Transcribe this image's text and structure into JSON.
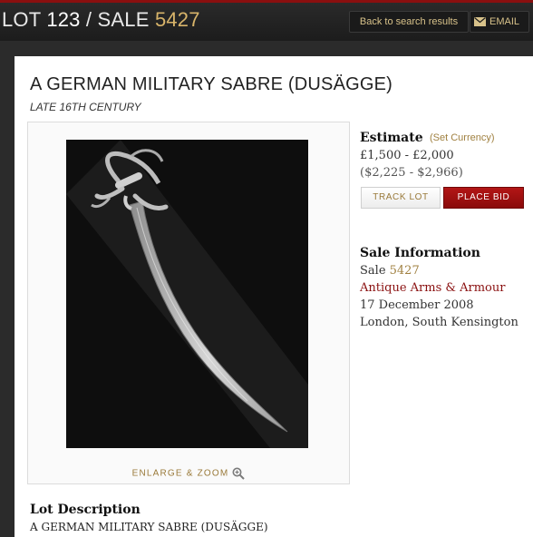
{
  "header": {
    "lot_prefix": "LOT ",
    "lot_number": "123",
    "separator": " / SALE ",
    "sale_number": "5427",
    "back_label": "Back to search results",
    "email_label": "EMAIL"
  },
  "lot": {
    "title": "A GERMAN MILITARY SABRE (DUSÄGGE)",
    "subtitle": "LATE 16TH CENTURY",
    "enlarge_label": "ENLARGE & ZOOM"
  },
  "estimate": {
    "label": "Estimate",
    "set_currency": "(Set Currency)",
    "gbp": "£1,500 - £2,000",
    "usd": "($2,225 - $2,966)",
    "track_label": "TRACK LOT",
    "bid_label": "PLACE BID"
  },
  "sale_info": {
    "label": "Sale Information",
    "sale_prefix": "Sale ",
    "sale_number": "5427",
    "sale_name": "Antique Arms & Armour",
    "date": "17 December 2008",
    "location": "London, South Kensington"
  },
  "description": {
    "label": "Lot Description",
    "text": "A GERMAN MILITARY SABRE (DUSÄGGE)"
  },
  "colors": {
    "accent_gold": "#d8b46a",
    "bid_red": "#a01010",
    "header_bg": "#1c1c1c"
  }
}
